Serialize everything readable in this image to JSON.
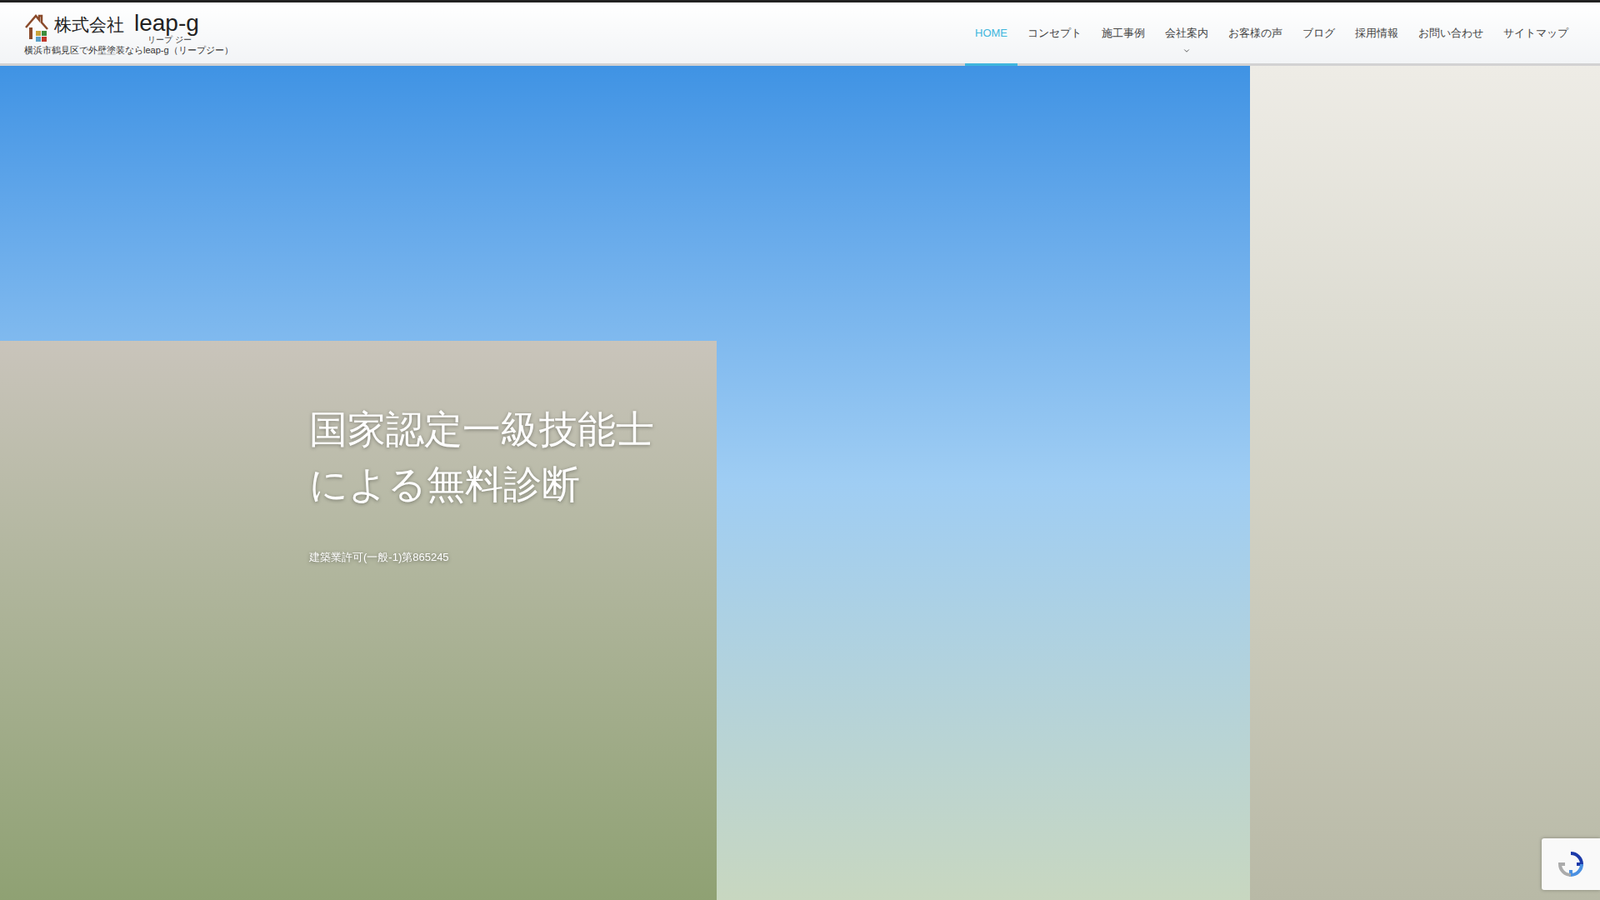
{
  "header": {
    "company": "株式会社",
    "brand": "leap-g",
    "reading": "リープ ジー",
    "tagline": "横浜市鶴見区で外壁塗装ならleap-g（リープジー）"
  },
  "nav": [
    {
      "label": "HOME",
      "selected": true,
      "dropdown": false
    },
    {
      "label": "コンセプト",
      "selected": false,
      "dropdown": false
    },
    {
      "label": "施工事例",
      "selected": false,
      "dropdown": false
    },
    {
      "label": "会社案内",
      "selected": false,
      "dropdown": true
    },
    {
      "label": "お客様の声",
      "selected": false,
      "dropdown": false
    },
    {
      "label": "ブログ",
      "selected": false,
      "dropdown": false
    },
    {
      "label": "採用情報",
      "selected": false,
      "dropdown": false
    },
    {
      "label": "お問い合わせ",
      "selected": false,
      "dropdown": false
    },
    {
      "label": "サイトマップ",
      "selected": false,
      "dropdown": false
    }
  ],
  "hero": {
    "headline": [
      "国家認定一級技能士",
      "による無料診断"
    ],
    "license": "建築業許可(一般-1)第865245"
  }
}
